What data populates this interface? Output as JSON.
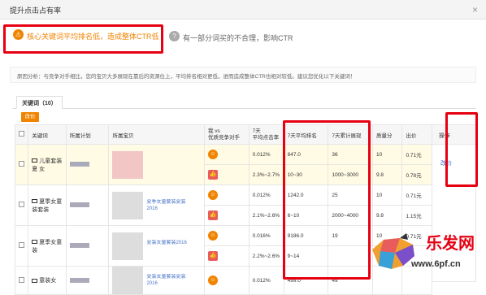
{
  "dialog": {
    "title": "提升点击占有率",
    "close_glyph": "×"
  },
  "reasons": [
    {
      "icon": "⚠",
      "text": "核心关键词平均排名低，造成整体CTR低"
    },
    {
      "icon": "?",
      "text": "有一部分词买的不合理，影响CTR"
    }
  ],
  "analysis": "原因分析：与竞争对手相比，您的宝贝大多展现在靠后的资源位上，平均排名相对更低，进而造成整体CTR也相对较低。建议您优化以下关键词！",
  "tab": {
    "label": "关键词（10）"
  },
  "adjust_button": "改价",
  "table": {
    "headers": [
      "关键词",
      "所属计划",
      "所属宝贝",
      "我 vs\n优质竞争对手",
      "7天\n平均点击率",
      "7天平均排名",
      "7天累计展现",
      "质量分",
      "出价"
    ],
    "rows": [
      {
        "keyword": "儿童套装 夏 女",
        "pc": false,
        "title": "",
        "compare": "mine",
        "ctr": "0.012%",
        "rank": "847.0",
        "impressions": "36",
        "quality": "10",
        "bid": "0.71元",
        "hl": true
      },
      {
        "keyword": "",
        "pc": false,
        "title": "",
        "compare": "rival",
        "ctr": "2.3%~2.7%",
        "rank": "10~30",
        "impressions": "1000~3000",
        "quality": "9.8",
        "bid": "0.78元",
        "hl": true
      },
      {
        "keyword": "夏季女童装套装",
        "pc": true,
        "title": "夏季女童套装夏装2016",
        "compare": "mine",
        "ctr": "0.012%",
        "rank": "1242.0",
        "impressions": "25",
        "quality": "10",
        "bid": "0.71元",
        "hl": false
      },
      {
        "keyword": "",
        "pc": false,
        "title": "",
        "compare": "rival",
        "ctr": "2.1%~2.6%",
        "rank": "6~10",
        "impressions": "2000~4000",
        "quality": "9.8",
        "bid": "1.15元",
        "hl": false
      },
      {
        "keyword": "夏季女童装",
        "pc": true,
        "title": "夏装女童套装2016",
        "compare": "mine",
        "ctr": "0.016%",
        "rank": "9186.0",
        "impressions": "19",
        "quality": "10",
        "bid": "0.71元",
        "hl": false
      },
      {
        "keyword": "",
        "pc": false,
        "title": "",
        "compare": "rival",
        "ctr": "2.2%~2.6%",
        "rank": "9~14",
        "impressions": "",
        "quality": "",
        "bid": "",
        "hl": false
      },
      {
        "keyword": "童装女",
        "pc": true,
        "title": "夏装女童套装夏装2016",
        "compare": "mine",
        "ctr": "0.012%",
        "rank": "499.0",
        "impressions": "49",
        "quality": "",
        "bid": "",
        "hl": false
      }
    ]
  },
  "operation": {
    "header": "操作",
    "link": "改价"
  },
  "watermark": {
    "brand": "乐发网",
    "url": "www.6pf.cn"
  },
  "colors": {
    "accent": "#f08300",
    "highlight": "#e60012",
    "link": "#3366cc"
  }
}
